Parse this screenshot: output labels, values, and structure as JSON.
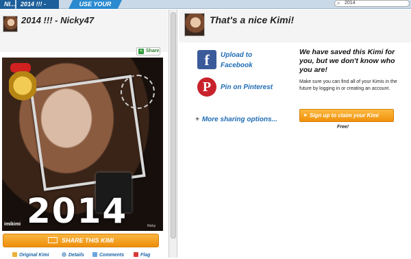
{
  "tabs": [
    "NI...",
    "2014 !!! - NI...",
    "USE YOUR KIMI"
  ],
  "search": {
    "value": "2014"
  },
  "left": {
    "title": "2014 !!! - Nicky47",
    "share_mini": "Share",
    "photo": {
      "year_text": "2014",
      "watermark": "imikimi",
      "signature": "Nicky"
    },
    "share_button": "SHARE THIS KIMI",
    "links": {
      "original": "Original Kimi",
      "details": "Details",
      "comments": "Comments",
      "flag": "Flag"
    }
  },
  "right": {
    "title": "That's a nice Kimi!",
    "facebook": "Upload to Facebook",
    "pinterest": "Pin on Pinterest",
    "more": "More sharing options...",
    "saved_title": "We have saved this Kimi for you, but we don't know who you are!",
    "saved_body": "Make sure you can find all of your Kimis in the future by logging in or creating an account.",
    "claim_button": "Sign up to claim your Kimi",
    "free": "Free!"
  },
  "colors": {
    "accent": "#f1910b",
    "link": "#1f6db5",
    "facebook": "#3b5a9a",
    "pinterest": "#c8232c",
    "tab": "#1c5f9a"
  },
  "icons": [
    "search-icon",
    "share-icon",
    "facebook-icon",
    "pinterest-icon",
    "plus-icon",
    "arrow-icon",
    "camera-icon",
    "magnifier-icon",
    "comments-icon",
    "flag-icon",
    "original-icon"
  ]
}
